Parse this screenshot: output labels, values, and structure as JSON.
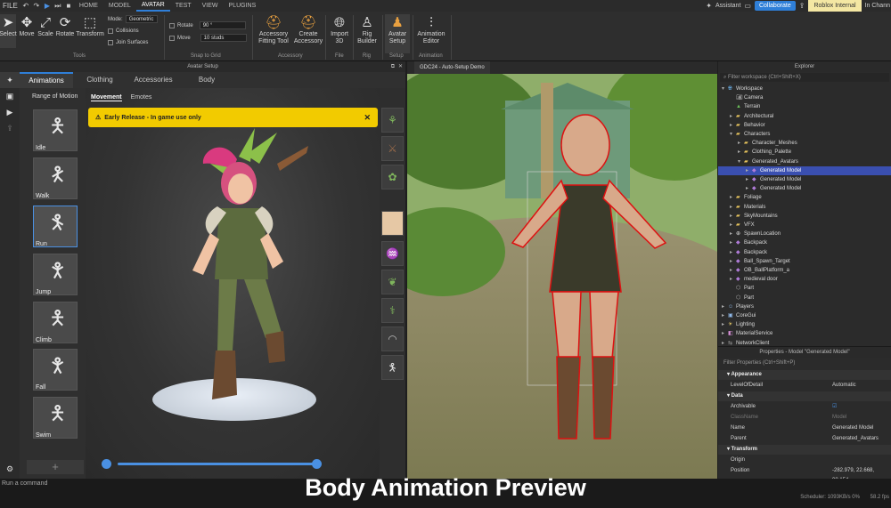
{
  "menu": {
    "items": [
      "FILE",
      "HOME",
      "MODEL",
      "AVATAR",
      "TEST",
      "VIEW",
      "PLUGINS"
    ],
    "active": "AVATAR",
    "assistant": "Assistant",
    "collaborate": "Collaborate",
    "roblox_internal": "Roblox Internal",
    "in_channel": "In Chann"
  },
  "ribbon": {
    "select": "Select",
    "move": "Move",
    "scale": "Scale",
    "rotate": "Rotate",
    "transform": "Transform",
    "mode_label": "Mode:",
    "mode_value": "Geometric",
    "collisions": "Collisions",
    "join_surfaces": "Join Surfaces",
    "rotate_label": "Rotate",
    "rotate_value": "90 °",
    "move_label": "Move",
    "move_value": "10 studs",
    "group_tools": "Tools",
    "group_snap": "Snap to Grid",
    "accessory_fitting": "Accessory Fitting Tool",
    "create_accessory": "Create Accessory",
    "group_accessory": "Accessory",
    "import_3d": "Import 3D",
    "group_file": "File",
    "rig_builder": "Rig Builder",
    "group_rig": "Rig",
    "avatar_setup": "Avatar Setup",
    "group_setup": "Setup",
    "animation_editor": "Animation Editor",
    "group_animation": "Animation"
  },
  "avatar_setup": {
    "title": "Avatar Setup",
    "tabs": [
      "Animations",
      "Clothing",
      "Accessories",
      "Body"
    ],
    "range_of_motion": "Range of Motion",
    "subtabs": [
      "Movement",
      "Emotes"
    ],
    "banner": "Early Release - In game use only",
    "animations": [
      "Idle",
      "Walk",
      "Run",
      "Jump",
      "Climb",
      "Fall",
      "Swim"
    ],
    "selected_animation": "Run",
    "accent": "#4a90e2"
  },
  "scene": {
    "tab": "GDC24 - Auto-Setup Demo"
  },
  "explorer": {
    "title": "Explorer",
    "filter": "Filter workspace (Ctrl+Shift+X)",
    "items": [
      {
        "label": "Workspace",
        "depth": 0,
        "arrow": "v",
        "icon": "globe"
      },
      {
        "label": "Camera",
        "depth": 1,
        "arrow": "",
        "icon": "camera"
      },
      {
        "label": "Terrain",
        "depth": 1,
        "arrow": "",
        "icon": "terrain"
      },
      {
        "label": "Architectural",
        "depth": 1,
        "arrow": ">",
        "icon": "folder"
      },
      {
        "label": "Behavior",
        "depth": 1,
        "arrow": ">",
        "icon": "folder"
      },
      {
        "label": "Characters",
        "depth": 1,
        "arrow": "v",
        "icon": "folder"
      },
      {
        "label": "Character_Meshes",
        "depth": 2,
        "arrow": ">",
        "icon": "folder"
      },
      {
        "label": "Clothing_Palette",
        "depth": 2,
        "arrow": ">",
        "icon": "folder"
      },
      {
        "label": "Generated_Avatars",
        "depth": 2,
        "arrow": "v",
        "icon": "folder"
      },
      {
        "label": "Generated Model",
        "depth": 3,
        "arrow": ">",
        "icon": "model"
      },
      {
        "label": "Generated Model",
        "depth": 3,
        "arrow": ">",
        "icon": "model"
      },
      {
        "label": "Generated Model",
        "depth": 3,
        "arrow": ">",
        "icon": "model"
      },
      {
        "label": "Foliage",
        "depth": 1,
        "arrow": ">",
        "icon": "folder"
      },
      {
        "label": "Materials",
        "depth": 1,
        "arrow": ">",
        "icon": "folder"
      },
      {
        "label": "SkyMountains",
        "depth": 1,
        "arrow": ">",
        "icon": "folder"
      },
      {
        "label": "VFX",
        "depth": 1,
        "arrow": ">",
        "icon": "folder"
      },
      {
        "label": "SpawnLocation",
        "depth": 1,
        "arrow": ">",
        "icon": "spawn"
      },
      {
        "label": "Backpack",
        "depth": 1,
        "arrow": ">",
        "icon": "model"
      },
      {
        "label": "Backpack",
        "depth": 1,
        "arrow": ">",
        "icon": "model"
      },
      {
        "label": "Ball_Spawn_Target",
        "depth": 1,
        "arrow": ">",
        "icon": "model"
      },
      {
        "label": "OB_BallPlatform_a",
        "depth": 1,
        "arrow": ">",
        "icon": "model"
      },
      {
        "label": "medieval door",
        "depth": 1,
        "arrow": ">",
        "icon": "model"
      },
      {
        "label": "Part",
        "depth": 1,
        "arrow": "",
        "icon": "part"
      },
      {
        "label": "Part",
        "depth": 1,
        "arrow": "",
        "icon": "part"
      },
      {
        "label": "Players",
        "depth": 0,
        "arrow": ">",
        "icon": "players"
      },
      {
        "label": "CoreGui",
        "depth": 0,
        "arrow": ">",
        "icon": "gui"
      },
      {
        "label": "Lighting",
        "depth": 0,
        "arrow": ">",
        "icon": "light"
      },
      {
        "label": "MaterialService",
        "depth": 0,
        "arrow": ">",
        "icon": "mat"
      },
      {
        "label": "NetworkClient",
        "depth": 0,
        "arrow": ">",
        "icon": "net"
      }
    ],
    "selected_index": 9
  },
  "properties": {
    "title": "Properties - Model \"Generated Model\"",
    "filter": "Filter Properties (Ctrl+Shift+P)",
    "rows": [
      {
        "type": "sec",
        "k": "Appearance",
        "v": ""
      },
      {
        "type": "row",
        "k": "LevelOfDetail",
        "v": "Automatic"
      },
      {
        "type": "sec",
        "k": "Data",
        "v": ""
      },
      {
        "type": "row",
        "k": "Archivable",
        "v": "☑"
      },
      {
        "type": "dim",
        "k": "ClassName",
        "v": "Model"
      },
      {
        "type": "row",
        "k": "Name",
        "v": "Generated Model"
      },
      {
        "type": "row",
        "k": "Parent",
        "v": "Generated_Avatars"
      },
      {
        "type": "sec",
        "k": "Transform",
        "v": ""
      },
      {
        "type": "row",
        "k": "Origin",
        "v": ""
      },
      {
        "type": "row",
        "k": "Position",
        "v": "-282.979, 22.668, 98.154"
      }
    ]
  },
  "bottom": {
    "command_placeholder": "Run a command",
    "caption": "Body Animation Preview",
    "scheduler": "Scheduler: 1093KB/s 0%",
    "fps": "58.2 fps"
  }
}
